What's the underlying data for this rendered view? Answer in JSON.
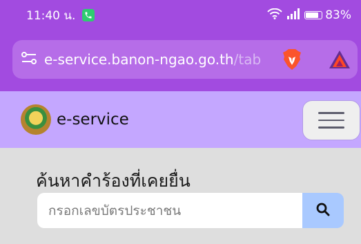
{
  "status_bar": {
    "time": "11:40 น.",
    "battery": "83%",
    "battery_level": 0.83
  },
  "browser": {
    "url_domain": "e-service.banon-ngao.go.th",
    "url_path": "/tab"
  },
  "site": {
    "title": "e-service"
  },
  "search": {
    "heading": "ค้นหาคำร้องที่เคยยื่น",
    "placeholder": "กรอกเลขบัตรประชาชน"
  },
  "colors": {
    "browser_purple": "#a24be0",
    "header_lavender": "#c4a7ff",
    "search_button": "#a9c9ff"
  }
}
